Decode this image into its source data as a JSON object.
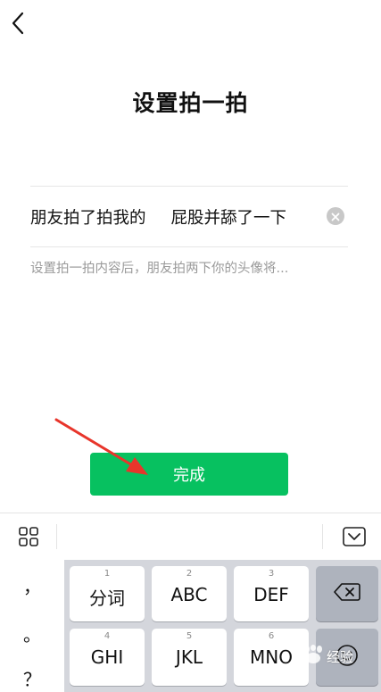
{
  "header": {
    "back_icon": "chevron-left-icon",
    "title": "设置拍一拍"
  },
  "form": {
    "prefix": "朋友拍了拍我的",
    "value": "屁股并舔了一下",
    "clear_icon": "clear-circle-icon",
    "hint": "设置拍一拍内容后，朋友拍两下你的头像将..."
  },
  "done_button": {
    "label": "完成",
    "color": "#07c160"
  },
  "keyboard": {
    "toolbar": {
      "grid_icon": "grid-icon",
      "hide_icon": "keyboard-hide-icon"
    },
    "punctuation": [
      "，",
      "。",
      "？"
    ],
    "keys": [
      {
        "num": "1",
        "label": "分词"
      },
      {
        "num": "2",
        "label": "ABC"
      },
      {
        "num": "3",
        "label": "DEF"
      },
      {
        "num": "4",
        "label": "GHI"
      },
      {
        "num": "5",
        "label": "JKL"
      },
      {
        "num": "6",
        "label": "MNO"
      }
    ],
    "backspace_icon": "backspace-icon",
    "emoji_icon": "emoji-icon"
  },
  "watermark": {
    "text": "经验",
    "logo": "baidu-paw-logo"
  },
  "annotation": {
    "arrow_color": "#e8352b",
    "arrow_icon": "red-arrow-icon"
  }
}
